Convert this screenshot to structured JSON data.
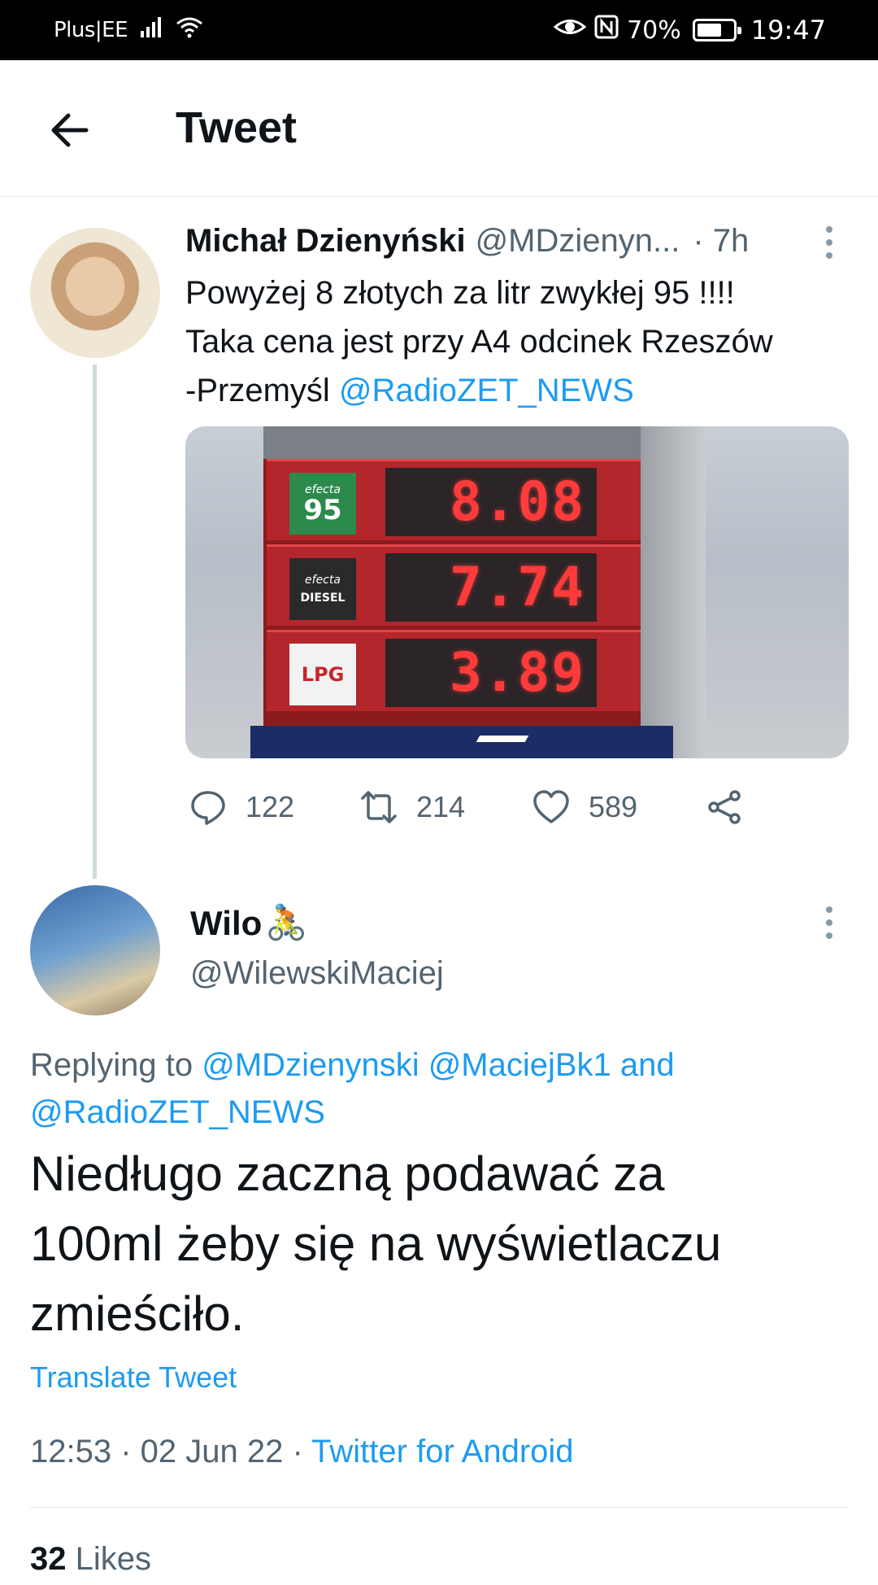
{
  "status_bar": {
    "carrier": "Plus|EE",
    "battery_percent": "70%",
    "battery_level": 0.7,
    "time": "19:47",
    "icons": [
      "signal-icon",
      "wifi-icon",
      "eye-icon",
      "nfc-icon",
      "battery-icon"
    ]
  },
  "header": {
    "back_icon": "arrow-left-icon",
    "title": "Tweet"
  },
  "parent_tweet": {
    "author_name": "Michał Dzienyński",
    "author_handle": "@MDzienyn...",
    "time": "· 7h",
    "text_line1": "Powyżej 8 złotych za litr zwykłej 95 !!!!",
    "text_line2": "Taka cena jest przy A4 odcinek Rzeszów",
    "text_line3_prefix": "-Przemyśl ",
    "mention": "@RadioZET_NEWS",
    "image": {
      "fuel_rows": [
        {
          "brand": "efecta",
          "label": "95",
          "price": "8.08"
        },
        {
          "brand": "efecta",
          "label": "DIESEL",
          "price": "7.74"
        },
        {
          "brand": "",
          "label": "LPG",
          "price": "3.89"
        }
      ]
    },
    "replies": "122",
    "retweets": "214",
    "likes": "589"
  },
  "reply_tweet": {
    "author_name": "Wilo",
    "author_emoji": "🚴",
    "author_handle": "@WilewskiMaciej",
    "replying_to_label": "Replying to",
    "replying_to_mentions_1": "@MDzienynski @MaciejBk1 and",
    "replying_to_mentions_2": "@RadioZET_NEWS",
    "text_line1": "Niedługo zaczną podawać za",
    "text_line2": "100ml żeby się na wyświetlaczu",
    "text_line3": "zmieściło.",
    "translate_label": "Translate Tweet",
    "timestamp": "12:53 · 02 Jun 22 · ",
    "source": "Twitter for Android",
    "likes_count": "32",
    "likes_label": " Likes"
  },
  "colors": {
    "accent": "#1d9bf0",
    "secondary_text": "#536471",
    "primary_text": "#0f1419"
  }
}
